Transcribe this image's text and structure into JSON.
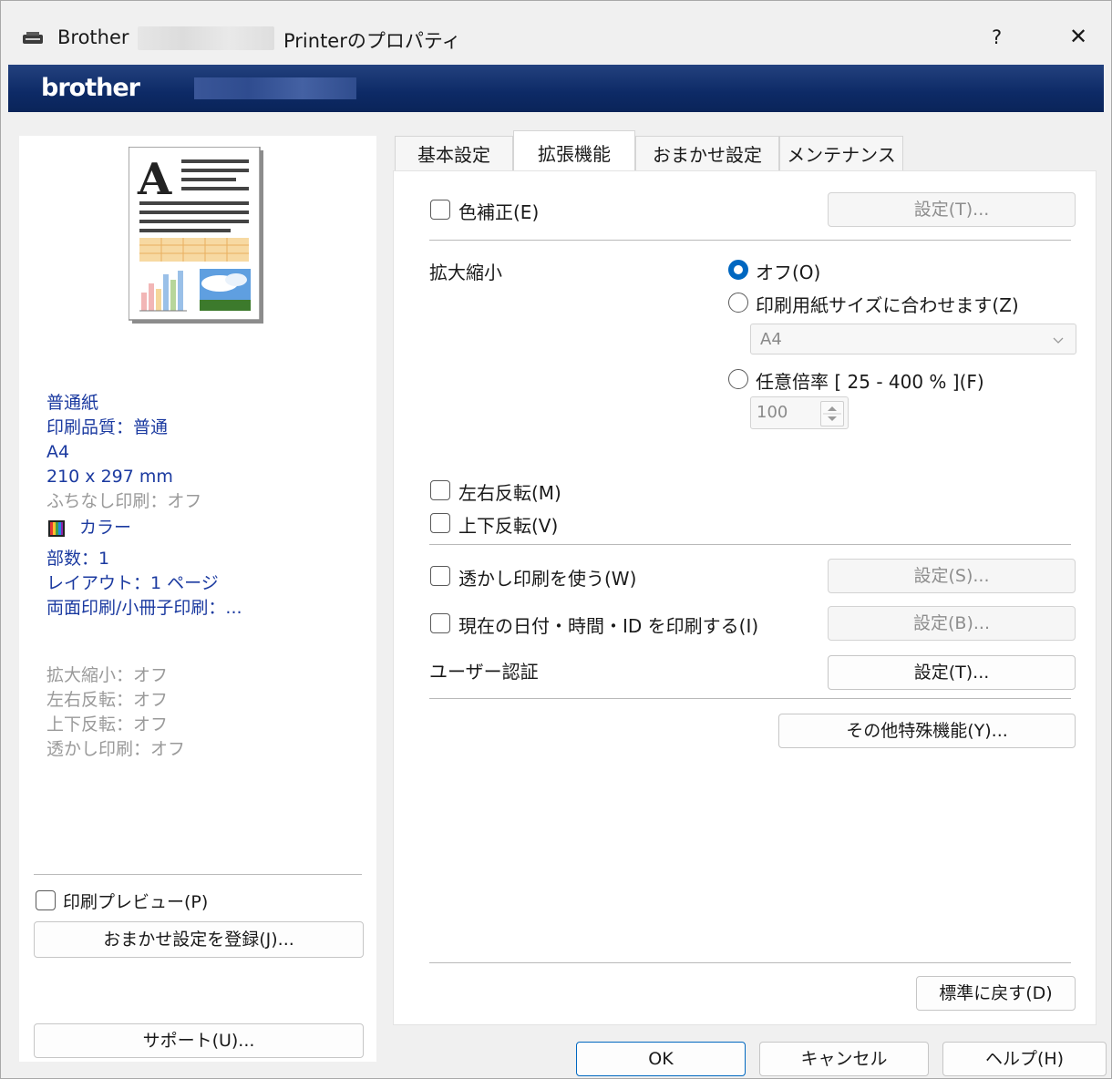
{
  "window": {
    "title_prefix": "Brother",
    "title_suffix": "Printerのプロパティ",
    "help_glyph": "?",
    "close_glyph": "✕",
    "logo": "brother"
  },
  "tabs": [
    {
      "label": "基本設定"
    },
    {
      "label": "拡張機能",
      "active": true
    },
    {
      "label": "おまかせ設定"
    },
    {
      "label": "メンテナンス"
    }
  ],
  "summary": {
    "blue_lines": [
      "普通紙",
      "印刷品質：普通",
      "A4",
      "210 x 297 mm"
    ],
    "gray_line": "ふちなし印刷：オフ",
    "color_line": "カラー",
    "blue_lines2": [
      "部数：1",
      "レイアウト：1 ページ",
      "両面印刷/小冊子印刷：..."
    ],
    "gray_lines": [
      "拡大縮小：オフ",
      "左右反転：オフ",
      "上下反転：オフ",
      "透かし印刷：オフ"
    ]
  },
  "left": {
    "preview_label": "印刷プレビュー(P)",
    "preview_checked": false,
    "register_button": "おまかせ設定を登録(J)...",
    "support_button": "サポート(U)..."
  },
  "ext": {
    "color_correction": {
      "label": "色補正(E)",
      "checked": false,
      "button": "設定(T)..."
    },
    "scaling": {
      "label": "拡大縮小",
      "options": [
        "オフ(O)",
        "印刷用紙サイズに合わせます(Z)",
        "任意倍率 [ 25 - 400 % ](F)"
      ],
      "selected_index": 0,
      "paper_size": "A4",
      "ratio": "100"
    },
    "mirror": {
      "label": "左右反転(M)",
      "checked": false
    },
    "flip": {
      "label": "上下反転(V)",
      "checked": false
    },
    "watermark": {
      "label": "透かし印刷を使う(W)",
      "checked": false,
      "button": "設定(S)..."
    },
    "datetime": {
      "label": "現在の日付・時間・ID を印刷する(I)",
      "checked": false,
      "button": "設定(B)..."
    },
    "user_auth": {
      "label": "ユーザー認証",
      "button": "設定(T)..."
    },
    "other_button": "その他特殊機能(Y)...",
    "default_button": "標準に戻す(D)"
  },
  "footer": {
    "ok": "OK",
    "cancel": "キャンセル",
    "help": "ヘルプ(H)"
  },
  "colors": {
    "accent": "#0067c0",
    "banner": "#0d2a66",
    "summary_blue": "#1b3aa0"
  }
}
